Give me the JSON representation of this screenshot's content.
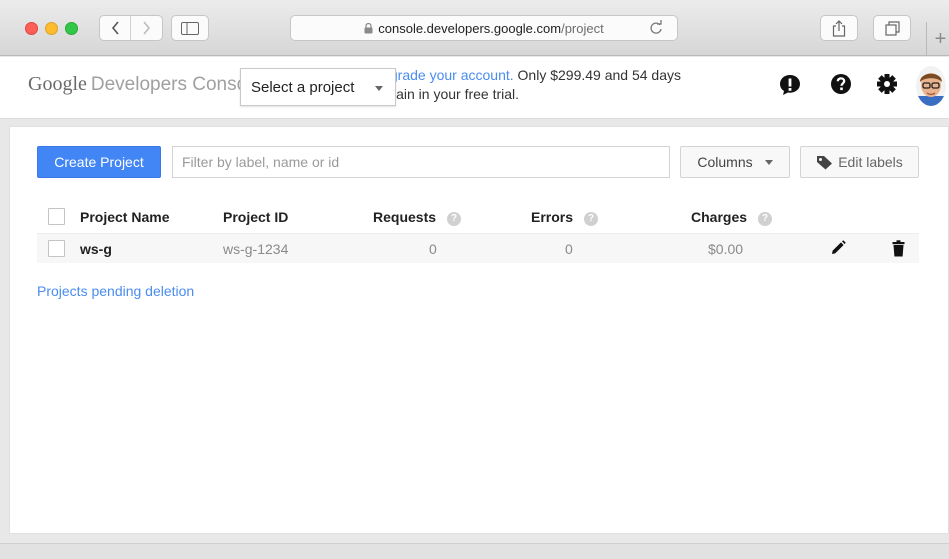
{
  "browser": {
    "url_host": "console.developers.google.com",
    "url_path": "/project",
    "new_tab_label": "+"
  },
  "header": {
    "logo_google": "Google",
    "logo_product": "Developers Console",
    "project_select_label": "Select a project",
    "upgrade_link": "Upgrade your account.",
    "upgrade_text_line1": " Only $299.49 and 54 days",
    "upgrade_text_line2": "remain in your free trial."
  },
  "toolbar": {
    "create_label": "Create Project",
    "filter_placeholder": "Filter by label, name or id",
    "columns_label": "Columns",
    "edit_labels_label": "Edit labels"
  },
  "table": {
    "columns": [
      "Project Name",
      "Project ID",
      "Requests",
      "Errors",
      "Charges"
    ],
    "help_glyph": "?",
    "rows": [
      {
        "name": "ws-g",
        "id": "ws-g-1234",
        "requests": "0",
        "errors": "0",
        "charges": "$0.00"
      }
    ]
  },
  "links": {
    "pending_deletion": "Projects pending deletion"
  },
  "colors": {
    "primary": "#4285f4",
    "link": "#4a8cf0"
  },
  "icons": [
    "lock-icon",
    "reload-icon",
    "share-icon",
    "tabs-icon",
    "feedback-icon",
    "help-icon",
    "settings-icon",
    "tag-icon",
    "edit-icon",
    "delete-icon"
  ]
}
